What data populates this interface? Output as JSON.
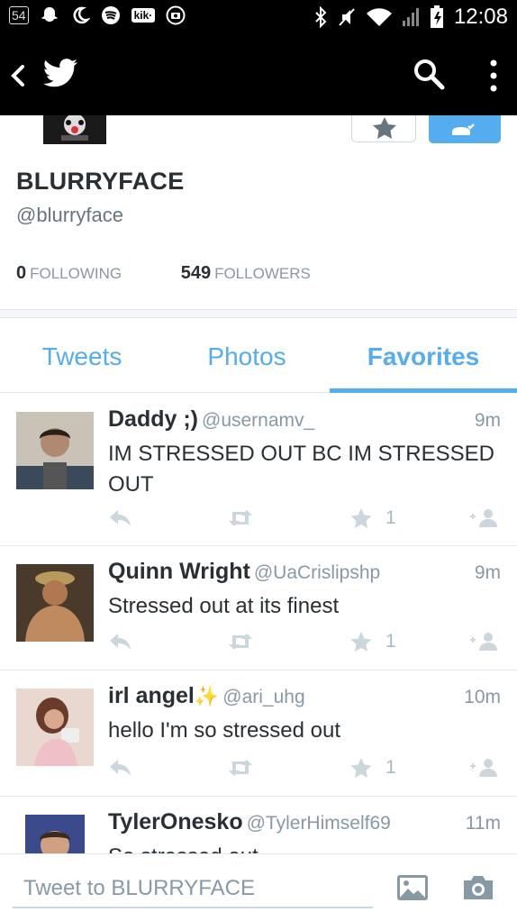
{
  "status_bar": {
    "notification_badge": "54",
    "kik_label": "kik·",
    "time": "12:08",
    "icons": [
      "ghost-icon",
      "moon-icon",
      "spotify-icon",
      "kik-icon",
      "camera-circle-icon",
      "bluetooth-icon",
      "mute-icon",
      "wifi-icon",
      "signal-icon",
      "battery-icon"
    ]
  },
  "app_bar": {
    "icons": [
      "back-chevron-icon",
      "twitter-bird-icon",
      "search-icon",
      "overflow-menu-icon"
    ]
  },
  "profile": {
    "name": "BLURRYFACE",
    "handle": "@blurryface",
    "following_count": "0",
    "following_label": "FOLLOWING",
    "followers_count": "549",
    "followers_label": "FOLLOWERS"
  },
  "tabs": [
    {
      "label": "Tweets",
      "selected": false
    },
    {
      "label": "Photos",
      "selected": false
    },
    {
      "label": "Favorites",
      "selected": true
    }
  ],
  "tweets": [
    {
      "name": "Daddy ;)",
      "handle": "@usernamv_",
      "time": "9m",
      "text": "IM STRESSED OUT BC IM STRESSED OUT",
      "favorites": "1"
    },
    {
      "name": "Quinn Wright",
      "handle": "@UaCrislipshp",
      "time": "9m",
      "text": "Stressed out at its finest",
      "favorites": "1"
    },
    {
      "name": "irl angel",
      "name_emoji": "✨",
      "handle": "@ari_uhg",
      "time": "10m",
      "text": "hello I'm so stressed out",
      "favorites": "1"
    },
    {
      "name": "TylerOnesko",
      "handle": "@TylerHimself69",
      "time": "11m",
      "text": "So stressed out",
      "favorites": ""
    }
  ],
  "compose": {
    "placeholder": "Tweet to BLURRYFACE"
  },
  "colors": {
    "accent": "#55acee",
    "muted": "#8899a6",
    "text": "#292f33"
  }
}
